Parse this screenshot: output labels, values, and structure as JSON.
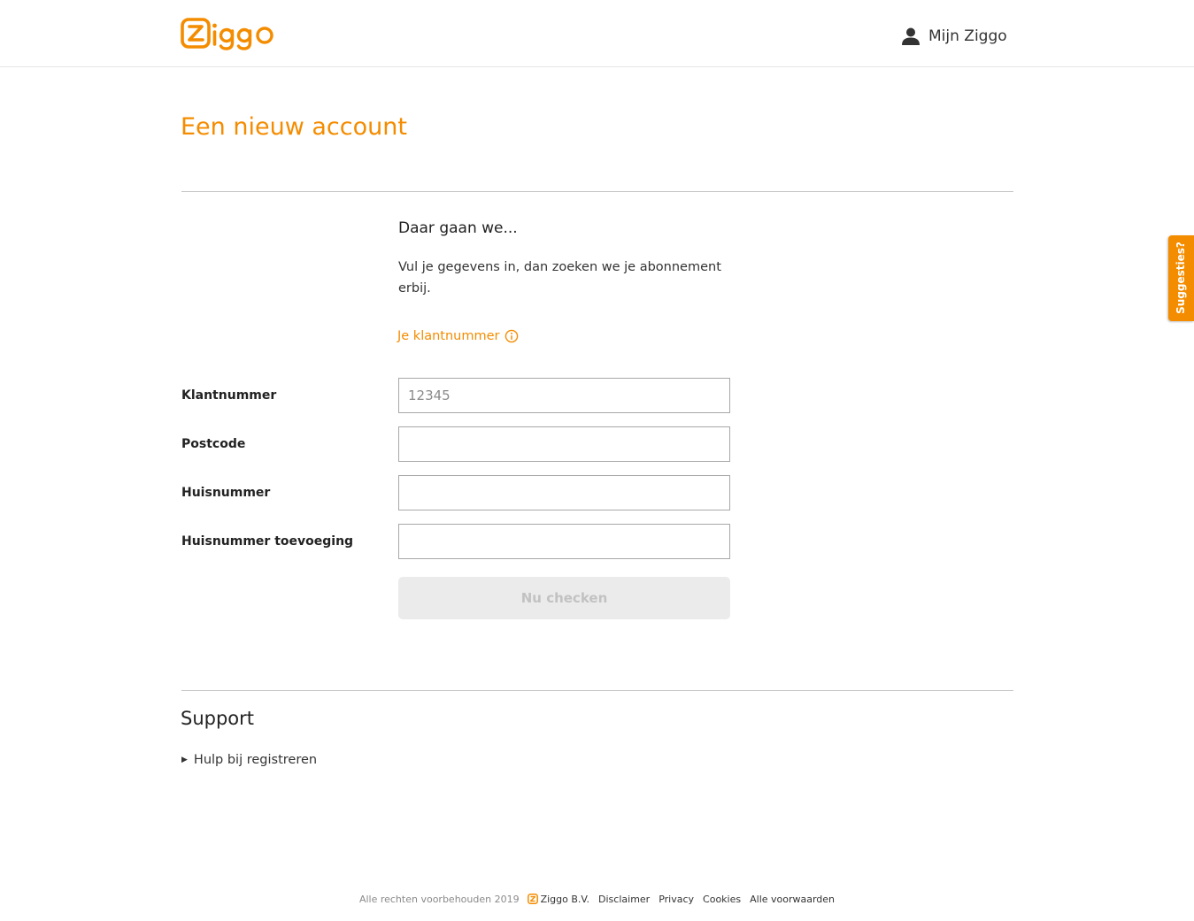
{
  "header": {
    "logo_text": "ziggo",
    "account_label": "Mijn Ziggo",
    "brand_color": "#f48c00"
  },
  "page": {
    "title": "Een nieuw account",
    "intro_heading": "Daar gaan we...",
    "intro_text": "Vul je gegevens in, dan zoeken we je abonnement erbij.",
    "klantnummer_link": "Je klantnummer"
  },
  "form": {
    "fields": [
      {
        "label": "Klantnummer",
        "value": "",
        "placeholder": "12345"
      },
      {
        "label": "Postcode",
        "value": "",
        "placeholder": ""
      },
      {
        "label": "Huisnummer",
        "value": "",
        "placeholder": ""
      },
      {
        "label": "Huisnummer toevoeging",
        "value": "",
        "placeholder": ""
      }
    ],
    "submit_label": "Nu checken"
  },
  "support": {
    "title": "Support",
    "items": [
      "Hulp bij registreren"
    ]
  },
  "footer": {
    "copyright": "Alle rechten voorbehouden 2019",
    "company": "Ziggo B.V.",
    "links": [
      "Disclaimer",
      "Privacy",
      "Cookies",
      "Alle voorwaarden"
    ]
  },
  "feedback_tab": {
    "label": "Suggesties?"
  },
  "icons": {
    "logo": "ziggo-logo",
    "account": "user-icon",
    "info": "info-icon",
    "expand": "triangle-right-icon",
    "footer_brand": "ziggo-z-icon"
  }
}
